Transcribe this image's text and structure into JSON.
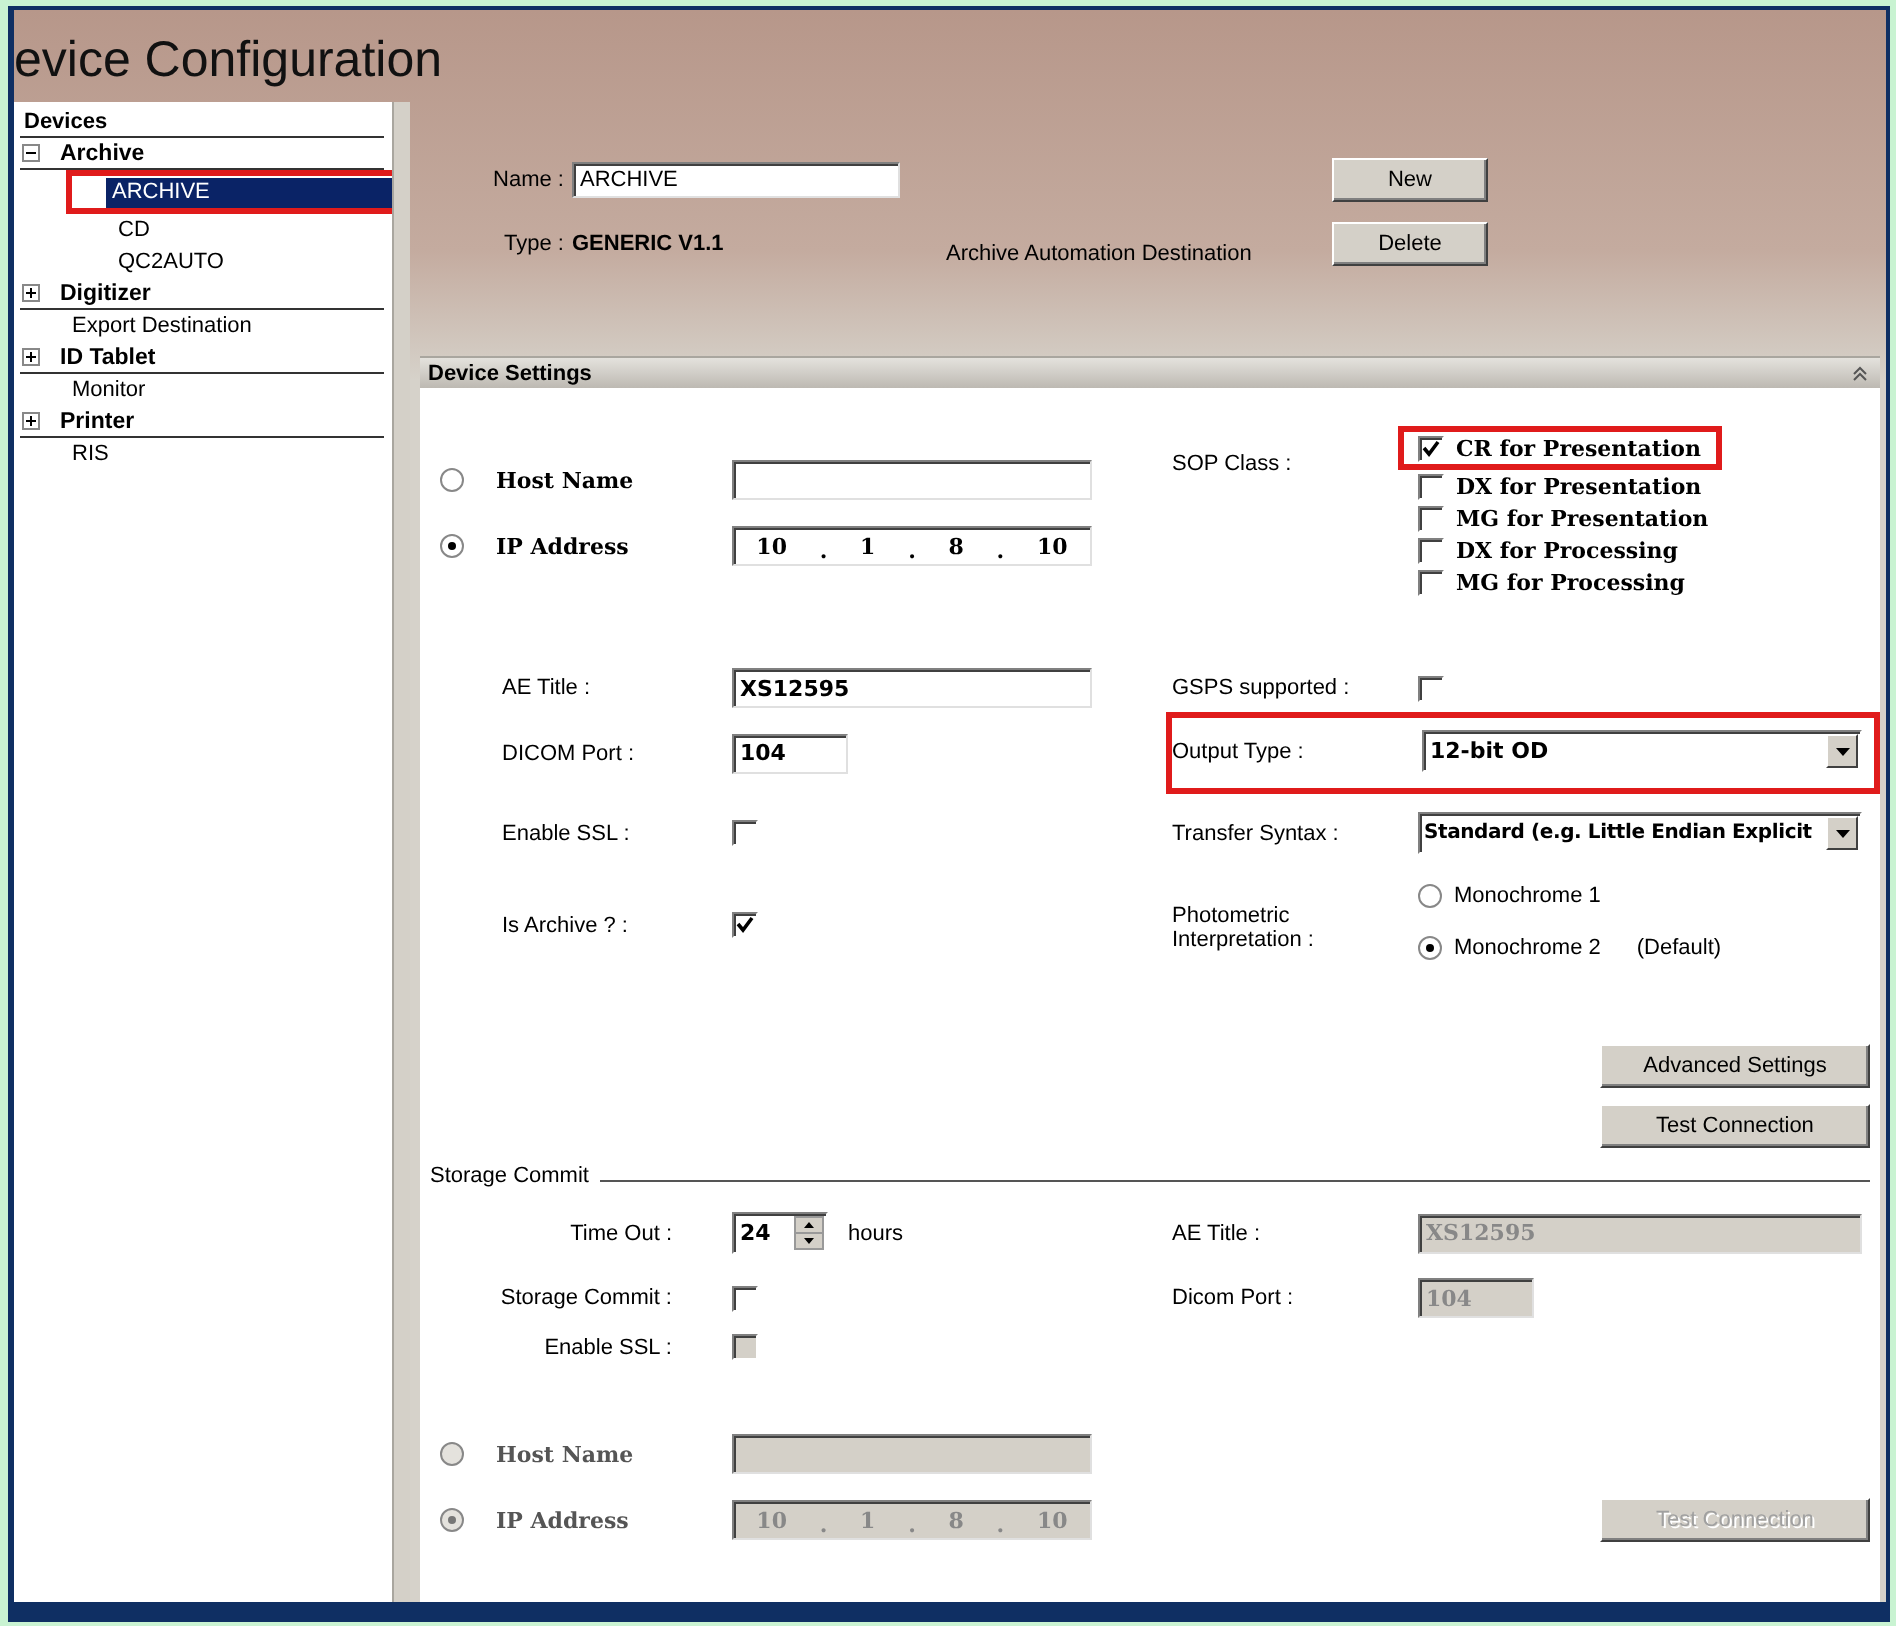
{
  "title": "evice Configuration",
  "sidebar": {
    "header": "Devices",
    "items": [
      {
        "label": "Archive",
        "kind": "group",
        "expanded": true,
        "children": [
          {
            "label": "ARCHIVE",
            "selected": true,
            "highlighted": true
          },
          {
            "label": "CD",
            "selected": false,
            "highlighted": false
          },
          {
            "label": "QC2AUTO",
            "selected": false,
            "highlighted": false
          }
        ]
      },
      {
        "label": "Digitizer",
        "kind": "group",
        "expanded": false
      },
      {
        "label": "Export Destination",
        "kind": "leaf"
      },
      {
        "label": "ID Tablet",
        "kind": "group",
        "expanded": false
      },
      {
        "label": "Monitor",
        "kind": "leaf"
      },
      {
        "label": "Printer",
        "kind": "group",
        "expanded": false
      },
      {
        "label": "RIS",
        "kind": "leaf"
      }
    ]
  },
  "header": {
    "name_label": "Name :",
    "name_value": "ARCHIVE",
    "type_label": "Type :",
    "type_value": "GENERIC V1.1",
    "note": "Archive Automation Destination",
    "buttons": [
      "New",
      "Delete"
    ]
  },
  "device_settings": {
    "title": "Device Settings",
    "address": [
      {
        "kind": "host",
        "label": "Host Name",
        "selected": false
      },
      {
        "kind": "ip",
        "label": "IP Address",
        "selected": true,
        "octets": [
          "10",
          "1",
          "8",
          "10"
        ],
        "separator": "."
      }
    ],
    "sop_class": {
      "label": "SOP Class :",
      "options": [
        {
          "label": "CR for Presentation",
          "checked": true,
          "highlighted": true
        },
        {
          "label": "DX for Presentation",
          "checked": false,
          "highlighted": false
        },
        {
          "label": "MG for Presentation",
          "checked": false,
          "highlighted": false
        },
        {
          "label": "DX for Processing",
          "checked": false,
          "highlighted": false
        },
        {
          "label": "MG for Processing",
          "checked": false,
          "highlighted": false
        }
      ]
    },
    "ae_title": {
      "label": "AE Title :",
      "value": "XS12595"
    },
    "gsps": {
      "label": "GSPS supported :",
      "checked": false
    },
    "dicom_port": {
      "label": "DICOM Port :",
      "value": "104"
    },
    "output_type": {
      "label": "Output Type :",
      "value": "12-bit OD",
      "highlighted": true
    },
    "enable_ssl": {
      "label": "Enable SSL :",
      "checked": false
    },
    "transfer_syntax": {
      "label": "Transfer Syntax :",
      "value": "Standard (e.g. Little Endian Explicit"
    },
    "is_archive": {
      "label": "Is Archive ? :",
      "checked": true
    },
    "photometric": {
      "label": "Photometric Interpretation :",
      "options": [
        {
          "label": "Monochrome 1",
          "selected": false
        },
        {
          "label": "Monochrome 2",
          "selected": true,
          "note": "(Default)"
        }
      ]
    },
    "buttons": [
      "Advanced Settings",
      "Test Connection"
    ]
  },
  "storage_commit": {
    "title": "Storage Commit",
    "time_out": {
      "label": "Time Out :",
      "value": "24",
      "unit": "hours"
    },
    "ae_title": {
      "label": "AE Title :",
      "value": "XS12595",
      "disabled": true
    },
    "storage_commit": {
      "label": "Storage Commit :",
      "checked": false,
      "disabled": false
    },
    "dicom_port": {
      "label": "Dicom Port :",
      "value": "104",
      "disabled": true
    },
    "enable_ssl": {
      "label": "Enable SSL :",
      "checked": false,
      "disabled": true
    },
    "address": [
      {
        "kind": "host",
        "label": "Host Name",
        "selected": false,
        "disabled": true
      },
      {
        "kind": "ip",
        "label": "IP Address",
        "selected": true,
        "disabled": true,
        "octets": [
          "10",
          "1",
          "8",
          "10"
        ],
        "separator": "."
      }
    ],
    "test_button": {
      "label": "Test Connection",
      "disabled": true
    }
  }
}
